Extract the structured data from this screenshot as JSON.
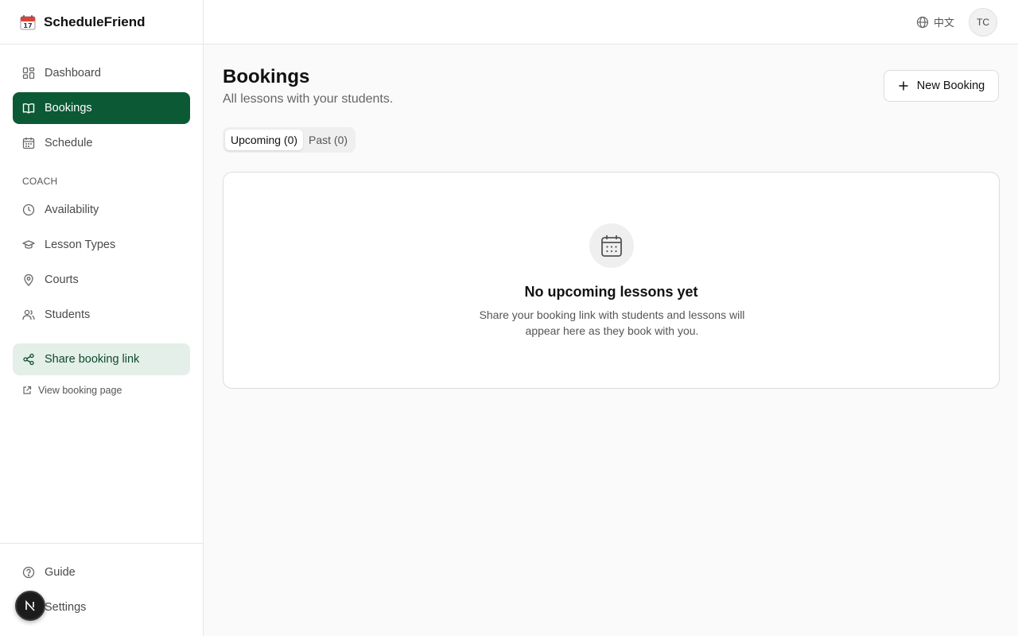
{
  "app": {
    "name": "ScheduleFriend",
    "icon": "calendar-emoji-icon"
  },
  "sidebar": {
    "items": [
      {
        "label": "Dashboard",
        "icon": "dashboard-grid-icon",
        "active": false
      },
      {
        "label": "Bookings",
        "icon": "book-open-icon",
        "active": true
      },
      {
        "label": "Schedule",
        "icon": "calendar-icon",
        "active": false
      }
    ],
    "section_label": "COACH",
    "coach_items": [
      {
        "label": "Availability",
        "icon": "clock-icon"
      },
      {
        "label": "Lesson Types",
        "icon": "graduation-cap-icon"
      },
      {
        "label": "Courts",
        "icon": "map-pin-icon"
      },
      {
        "label": "Students",
        "icon": "users-icon"
      }
    ],
    "share_label": "Share booking link",
    "view_label": "View booking page",
    "bottom_items": [
      {
        "label": "Guide",
        "icon": "help-circle-icon"
      },
      {
        "label": "Settings",
        "icon": "gear-icon"
      }
    ]
  },
  "topbar": {
    "language": "中文",
    "avatar_initials": "TC"
  },
  "main": {
    "title": "Bookings",
    "subtitle": "All lessons with your students.",
    "new_button": "New Booking",
    "tabs": [
      {
        "label": "Upcoming (0)",
        "active": true
      },
      {
        "label": "Past (0)",
        "active": false
      }
    ],
    "empty": {
      "title": "No upcoming lessons yet",
      "text": "Share your booking link with students and lessons will appear here as they book with you."
    }
  },
  "overlay": {
    "badge_letter": "N"
  },
  "colors": {
    "accent": "#0c5a35",
    "accent_soft": "#e3efe8"
  }
}
